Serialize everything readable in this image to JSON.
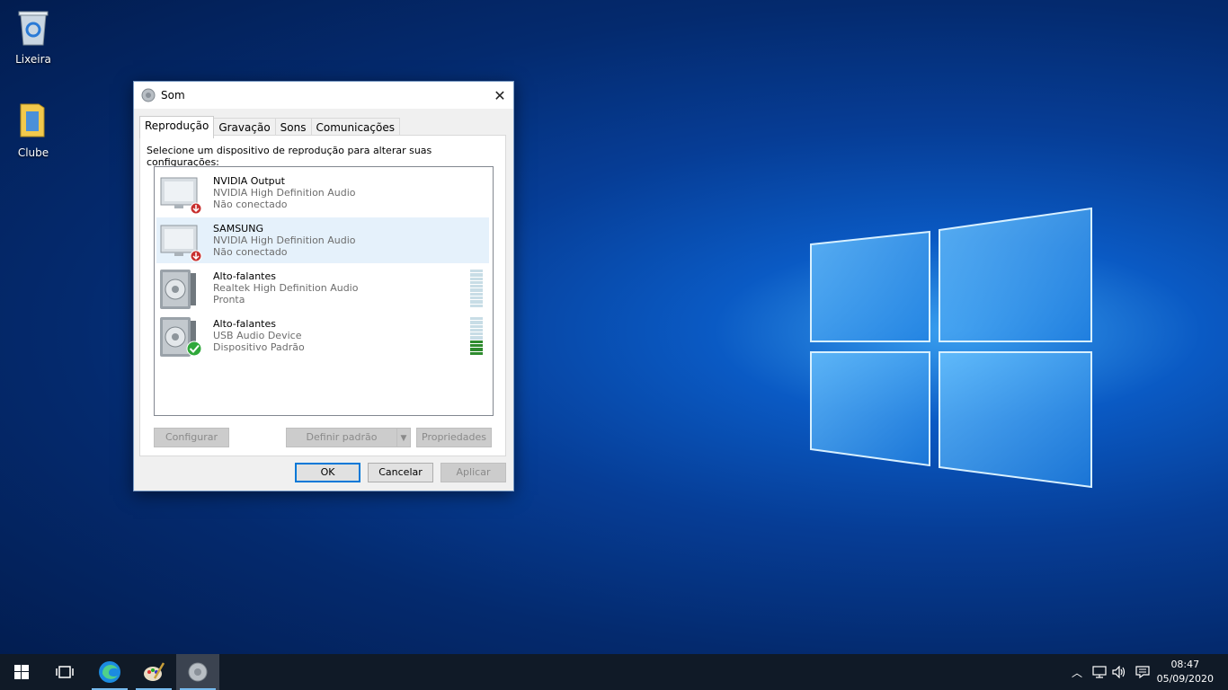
{
  "desktop": {
    "icons": [
      {
        "label": "Lixeira"
      },
      {
        "label": "Clube"
      }
    ]
  },
  "dialog": {
    "title": "Som",
    "tabs": [
      "Reprodução",
      "Gravação",
      "Sons",
      "Comunicações"
    ],
    "active_tab": "Reprodução",
    "instruction": "Selecione um dispositivo de reprodução para alterar suas configurações:",
    "devices": [
      {
        "name": "NVIDIA Output",
        "driver": "NVIDIA High Definition Audio",
        "status": "Não conectado",
        "icon": "monitor-icon",
        "badge": "disconnected"
      },
      {
        "name": "SAMSUNG",
        "driver": "NVIDIA High Definition Audio",
        "status": "Não conectado",
        "icon": "monitor-icon",
        "badge": "disconnected",
        "selected": true
      },
      {
        "name": "Alto-falantes",
        "driver": "Realtek High Definition Audio",
        "status": "Pronta",
        "icon": "speaker-icon",
        "level": 0
      },
      {
        "name": "Alto-falantes",
        "driver": "USB Audio Device",
        "status": "Dispositivo Padrão",
        "icon": "speaker-icon",
        "badge": "default",
        "level": 0.3
      }
    ],
    "buttons": {
      "configure": "Configurar",
      "set_default": "Definir padrão",
      "properties": "Propriedades",
      "ok": "OK",
      "cancel": "Cancelar",
      "apply": "Aplicar"
    }
  },
  "taskbar": {
    "time": "08:47",
    "date": "05/09/2020"
  },
  "colors": {
    "accent": "#0078d7",
    "selection": "#e5f1fb",
    "meter_on": "#2e8b2e"
  }
}
